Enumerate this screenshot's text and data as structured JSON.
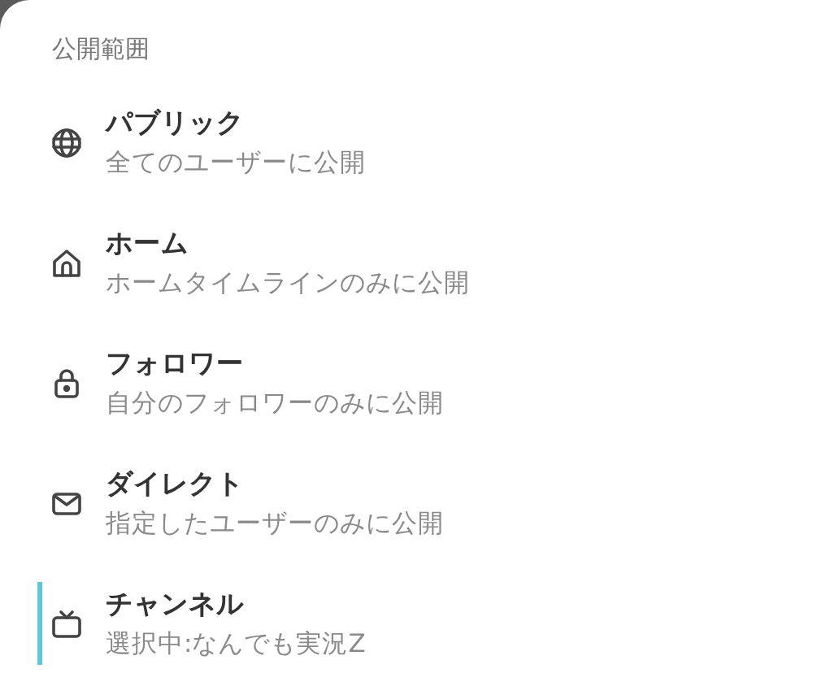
{
  "header": "公開範囲",
  "items": [
    {
      "kind": "public",
      "title": "パブリック",
      "description": "全てのユーザーに公開",
      "selected": false
    },
    {
      "kind": "home",
      "title": "ホーム",
      "description": "ホームタイムラインのみに公開",
      "selected": false
    },
    {
      "kind": "followers",
      "title": "フォロワー",
      "description": "自分のフォロワーのみに公開",
      "selected": false
    },
    {
      "kind": "direct",
      "title": "ダイレクト",
      "description": "指定したユーザーのみに公開",
      "selected": false
    },
    {
      "kind": "channel",
      "title": "チャンネル",
      "description": "選択中:なんでも実況Z",
      "selected": true
    }
  ]
}
